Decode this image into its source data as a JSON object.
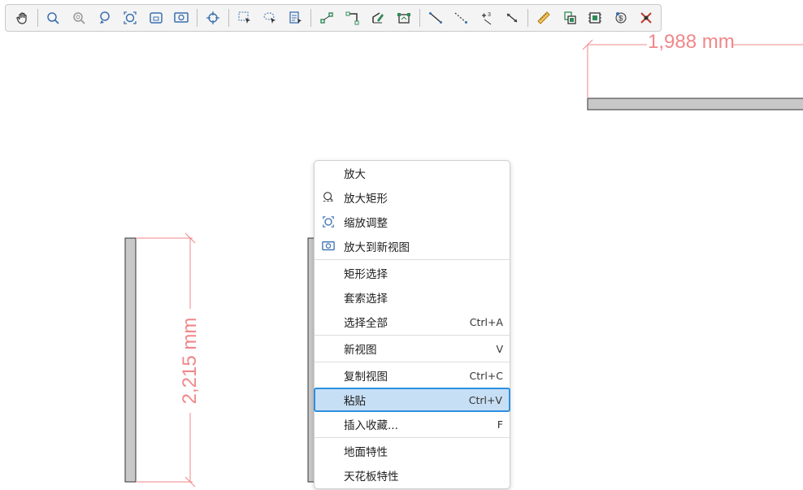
{
  "toolbar": {
    "buttons": [
      {
        "icon": "hand-pan-icon"
      },
      {
        "sep": true
      },
      {
        "icon": "zoom-icon"
      },
      {
        "icon": "zoom-dynamic-icon"
      },
      {
        "icon": "zoom-window-icon"
      },
      {
        "icon": "zoom-fit-icon"
      },
      {
        "icon": "zoom-selection-icon"
      },
      {
        "icon": "zoom-new-view-icon"
      },
      {
        "sep": true
      },
      {
        "icon": "snap-center-icon"
      },
      {
        "sep": true
      },
      {
        "icon": "rectangle-select-icon"
      },
      {
        "icon": "lasso-select-icon"
      },
      {
        "icon": "select-all-icon"
      },
      {
        "sep": true
      },
      {
        "icon": "connect-nodes-icon"
      },
      {
        "icon": "corner-join-icon"
      },
      {
        "icon": "edit-shape-icon"
      },
      {
        "icon": "edit-points-icon"
      },
      {
        "sep": true
      },
      {
        "icon": "dimension-line-icon"
      },
      {
        "icon": "dimension-dashed-icon"
      },
      {
        "icon": "dimension-add-icon"
      },
      {
        "icon": "dimension-arrows-icon"
      },
      {
        "sep": true
      },
      {
        "icon": "ruler-icon"
      },
      {
        "icon": "paste-layout-icon"
      },
      {
        "icon": "film-icon"
      },
      {
        "icon": "cost-icon"
      },
      {
        "icon": "delete-x-icon"
      }
    ]
  },
  "drawing": {
    "dim_top": "1,988 mm",
    "dim_left": "2,215 mm",
    "colors": {
      "dimension": "#f0878a",
      "wall": "#c8c8c8",
      "accent": "#2d8fe0"
    }
  },
  "context_menu": {
    "items": [
      {
        "label": "放大",
        "icon": "",
        "shortcut": ""
      },
      {
        "label": "放大矩形",
        "icon": "zoom-rect-icon",
        "shortcut": ""
      },
      {
        "label": "缩放调整",
        "icon": "zoom-fit-icon",
        "shortcut": ""
      },
      {
        "label": "放大到新视图",
        "icon": "zoom-new-view-icon",
        "shortcut": ""
      },
      {
        "separator": true
      },
      {
        "label": "矩形选择",
        "icon": "",
        "shortcut": ""
      },
      {
        "label": "套索选择",
        "icon": "",
        "shortcut": ""
      },
      {
        "label": "选择全部",
        "icon": "",
        "shortcut": "Ctrl+A"
      },
      {
        "separator": true
      },
      {
        "label": "新视图",
        "icon": "",
        "shortcut": "V"
      },
      {
        "separator": true
      },
      {
        "label": "复制视图",
        "icon": "",
        "shortcut": "Ctrl+C"
      },
      {
        "label": "粘贴",
        "icon": "",
        "shortcut": "Ctrl+V",
        "active": true
      },
      {
        "label": "插入收藏...",
        "icon": "",
        "shortcut": "F"
      },
      {
        "separator": true
      },
      {
        "label": "地面特性",
        "icon": "",
        "shortcut": ""
      },
      {
        "label": "天花板特性",
        "icon": "",
        "shortcut": ""
      }
    ]
  }
}
